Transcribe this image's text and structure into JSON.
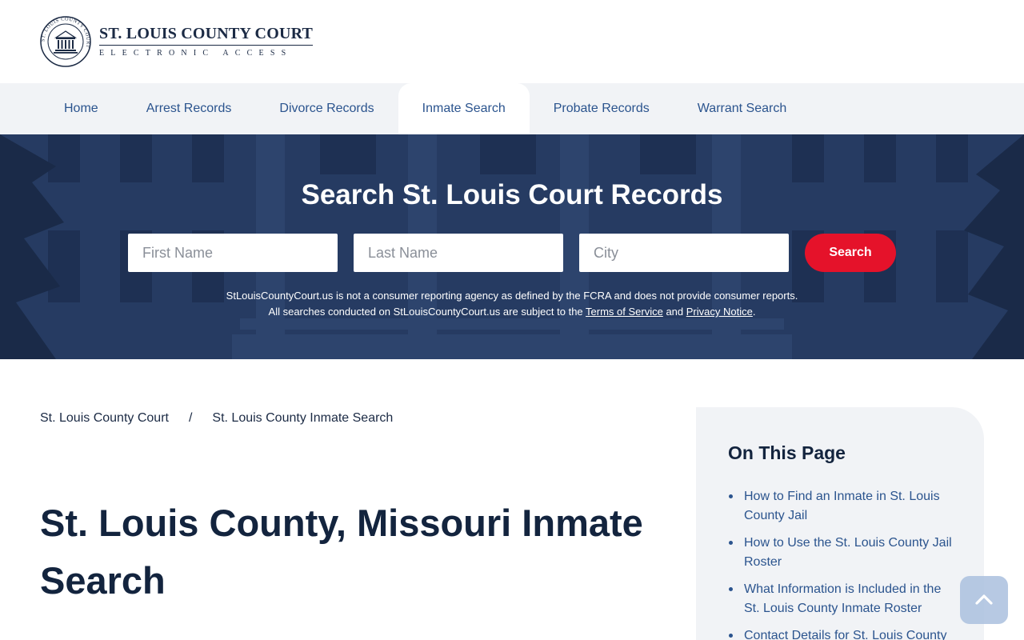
{
  "header": {
    "logo_title": "ST. LOUIS COUNTY COURT",
    "logo_subtitle": "ELECTRONIC ACCESS",
    "seal_ring_text": "ST. LOUIS COUNTY COURT"
  },
  "nav": {
    "items": [
      {
        "label": "Home",
        "active": false
      },
      {
        "label": "Arrest Records",
        "active": false
      },
      {
        "label": "Divorce Records",
        "active": false
      },
      {
        "label": "Inmate Search",
        "active": true
      },
      {
        "label": "Probate Records",
        "active": false
      },
      {
        "label": "Warrant Search",
        "active": false
      }
    ]
  },
  "hero": {
    "title": "Search St. Louis Court Records",
    "first_name_placeholder": "First Name",
    "last_name_placeholder": "Last Name",
    "city_placeholder": "City",
    "search_button": "Search",
    "disclaimer_line1": "StLouisCountyCourt.us is not a consumer reporting agency as defined by the FCRA and does not provide consumer reports.",
    "disclaimer_line2_prefix": "All searches conducted on StLouisCountyCourt.us are subject to the ",
    "terms_link": "Terms of Service",
    "and_text": " and ",
    "privacy_link": "Privacy Notice",
    "period": "."
  },
  "breadcrumb": {
    "home": "St. Louis County Court",
    "separator": "/",
    "current": "St. Louis County Inmate Search"
  },
  "main": {
    "title": "St. Louis County, Missouri Inmate Search"
  },
  "toc": {
    "title": "On This Page",
    "items": [
      "How to Find an Inmate in St. Louis County Jail",
      "How to Use the St. Louis County Jail Roster",
      "What Information is Included in the St. Louis County Inmate Roster",
      "Contact Details for St. Louis County"
    ]
  },
  "colors": {
    "nav_text": "#2b548e",
    "hero_overlay": "#24395f",
    "search_button": "#e5122a",
    "heading": "#13243e",
    "sidebar_bg": "#f1f3f6"
  },
  "icons": {
    "logo": "courthouse-seal-icon",
    "back_to_top": "chevron-up-icon"
  }
}
